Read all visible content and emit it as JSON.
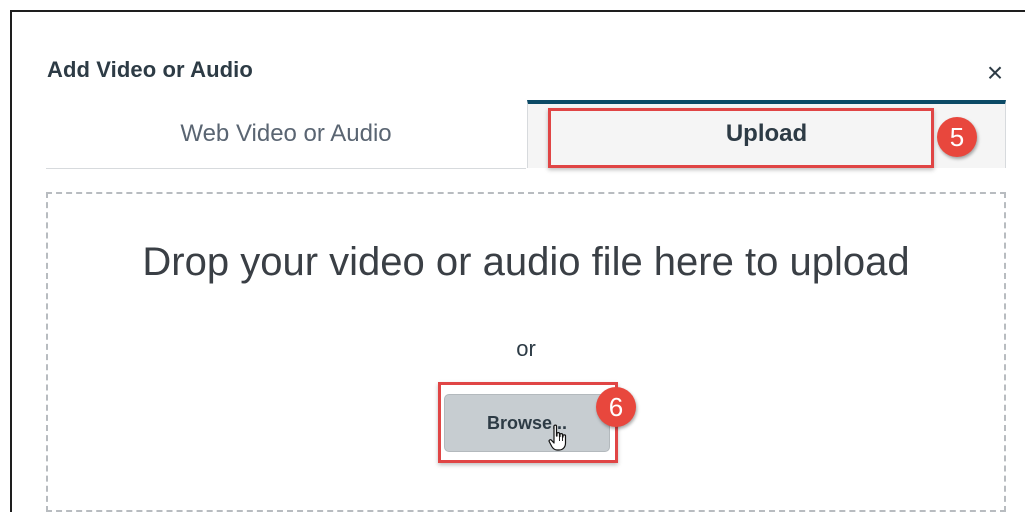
{
  "dialog": {
    "title": "Add Video or Audio",
    "close_glyph": "×"
  },
  "tabs": [
    {
      "label": "Web Video or Audio",
      "selected": false
    },
    {
      "label": "Upload",
      "selected": true
    }
  ],
  "dropzone": {
    "instruction": "Drop your video or audio file here to upload",
    "or_label": "or",
    "browse_label": "Browse..."
  },
  "annotations": {
    "step_upload": "5",
    "step_browse": "6"
  },
  "colors": {
    "accent_tab_border": "#0c4a66",
    "callout_red": "#e04545",
    "button_gray": "#c7cdd1"
  },
  "icons": {
    "close": "close-icon",
    "pointer": "hand-pointer-icon"
  }
}
